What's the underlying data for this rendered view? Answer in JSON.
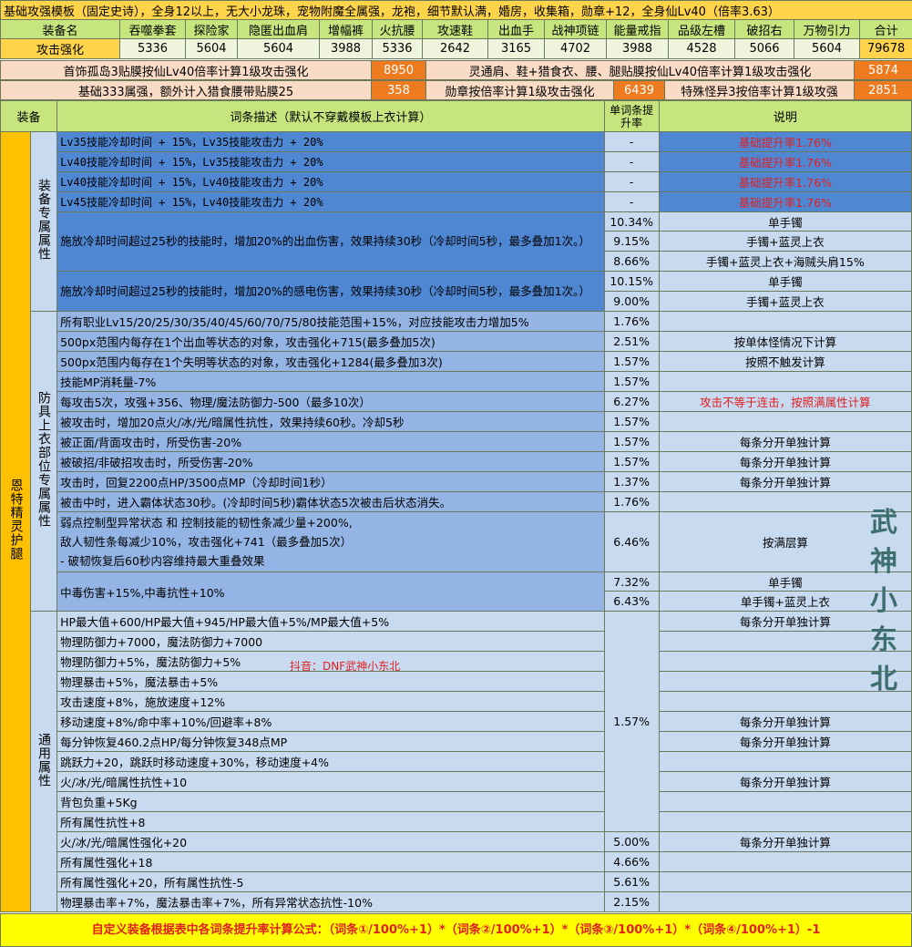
{
  "title": "基础攻强模板（固定史诗），全身12以上，无大小龙珠，宠物附魔全属强，龙袍，细节默认满，婚房，收集箱，勋章+12，全身仙Lv40（倍率3.63）",
  "header_row": {
    "label": "装备名",
    "items": [
      "吞噬拳套",
      "探险家",
      "隐匿出血肩",
      "增幅裤",
      "火抗腰",
      "攻速鞋",
      "出血手",
      "战神项链",
      "能量戒指",
      "品级左槽",
      "破招右",
      "万物引力"
    ],
    "total_label": "合计"
  },
  "attack_row": {
    "label": "攻击强化",
    "values": [
      "5336",
      "5604",
      "5604",
      "3988",
      "5336",
      "2642",
      "3165",
      "4702",
      "3988",
      "4528",
      "5066",
      "5604"
    ],
    "total": "79678"
  },
  "extra_rows": [
    {
      "left_label": "首饰孤岛3贴膜按仙Lv40倍率计算1级攻击强化",
      "left_value": "8950",
      "right_label": "灵通肩、鞋+猎食衣、腰、腿贴膜按仙Lv40倍率计算1级攻击强化",
      "right_value": "5874"
    },
    {
      "left_label": "基础333属强，额外计入猎食腰带贴膜25",
      "left_value": "358",
      "mid_label": "勋章按倍率计算1级攻击强化",
      "mid_value": "6439",
      "right_label": "特殊怪异3按倍率计算1级攻强",
      "right_value": "2851"
    }
  ],
  "table_header": {
    "equip": "装备",
    "desc": "词条描述（默认不穿戴模板上衣计算）",
    "rate": "单词条提升率",
    "note": "说明"
  },
  "equipment_name": "恩特精灵护腿",
  "groups": {
    "exclusive": "装备专属属性",
    "top": "防具上衣部位专属属性",
    "common": "通用属性"
  },
  "rows_exclusive": [
    {
      "desc": "Lv35技能冷却时间 + 15%，Lv35技能攻击力 + 20%",
      "rate": "-",
      "note": "基础提升率1.76%"
    },
    {
      "desc": "Lv40技能冷却时间 + 15%，Lv35技能攻击力 + 20%",
      "rate": "-",
      "note": "基础提升率1.76%"
    },
    {
      "desc": "Lv40技能冷却时间 + 15%，Lv40技能攻击力 + 20%",
      "rate": "-",
      "note": "基础提升率1.76%"
    },
    {
      "desc": "Lv45技能冷却时间 + 15%，Lv40技能攻击力 + 20%",
      "rate": "-",
      "note": "基础提升率1.76%"
    }
  ],
  "bleed_block": {
    "desc": "施放冷却时间超过25秒的技能时，增加20%的出血伤害，效果持续30秒（冷却时间5秒，最多叠加1次。）",
    "subs": [
      {
        "rate": "10.34%",
        "note": "单手镯"
      },
      {
        "rate": "9.15%",
        "note": "手镯+蓝灵上衣"
      },
      {
        "rate": "8.66%",
        "note": "手镯+蓝灵上衣+海贼头肩15%"
      }
    ]
  },
  "shock_block": {
    "desc": "施放冷却时间超过25秒的技能时，增加20%的感电伤害，效果持续30秒（冷却时间5秒，最多叠加1次。）",
    "subs": [
      {
        "rate": "10.15%",
        "note": "单手镯"
      },
      {
        "rate": "9.00%",
        "note": "手镯+蓝灵上衣"
      }
    ]
  },
  "rows_top": [
    {
      "desc": "所有职业Lv15/20/25/30/35/40/45/60/70/75/80技能范围+15%，对应技能攻击力增加5%",
      "rate": "1.76%",
      "note": ""
    },
    {
      "desc": "500px范围内每存在1个出血等状态的对象，攻击强化+715(最多叠加5次)",
      "rate": "2.51%",
      "note": "按单体怪情况下计算"
    },
    {
      "desc": "500px范围内每存在1个失明等状态的对象，攻击强化+1284(最多叠加3次)",
      "rate": "1.57%",
      "note": "按照不触发计算"
    },
    {
      "desc": "技能MP消耗量-7%",
      "rate": "1.57%",
      "note": ""
    },
    {
      "desc": "每攻击5次，攻强+356、物理/魔法防御力-500（最多10次）",
      "rate": "6.27%",
      "note": "攻击不等于连击，按照满属性计算"
    },
    {
      "desc": "被攻击时，增加20点火/冰/光/暗属性抗性，效果持续60秒。冷却5秒",
      "rate": "1.57%",
      "note": ""
    },
    {
      "desc": "被正面/背面攻击时，所受伤害-20%",
      "rate": "1.57%",
      "note": "每条分开单独计算"
    },
    {
      "desc": "被破招/非破招攻击时，所受伤害-20%",
      "rate": "1.57%",
      "note": "每条分开单独计算"
    },
    {
      "desc": "攻击时，回复2200点HP/3500点MP（冷却时间1秒）",
      "rate": "1.37%",
      "note": "每条分开单独计算"
    },
    {
      "desc": "被击中时，进入霸体状态30秒。(冷却时间5秒)霸体状态5次被击后状态消失。",
      "rate": "1.76%",
      "note": ""
    }
  ],
  "weak_block": {
    "lines": [
      "弱点控制型异常状态 和 控制技能的韧性条减少量+200%,",
      "敌人韧性条每减少10%，攻击强化+741（最多叠加5次）",
      "- 破韧恢复后60秒内容维持最大重叠效果"
    ],
    "rate": "6.46%",
    "note": "按满层算"
  },
  "poison_block": {
    "desc": "中毒伤害+15%,中毒抗性+10%",
    "subs": [
      {
        "rate": "7.32%",
        "note": "单手镯"
      },
      {
        "rate": "6.43%",
        "note": "单手镯+蓝灵上衣"
      }
    ]
  },
  "rows_common": [
    {
      "desc": "HP最大值+600/HP最大值+945/HP最大值+5%/MP最大值+5%",
      "note": "每条分开单独计算"
    },
    {
      "desc": "物理防御力+7000，魔法防御力+7000",
      "note": ""
    },
    {
      "desc": "物理防御力+5%，魔法防御力+5%",
      "note": ""
    },
    {
      "desc": "物理暴击+5%，魔法暴击+5%",
      "note": ""
    },
    {
      "desc": "攻击速度+8%，施放速度+12%",
      "note": ""
    },
    {
      "desc": "移动速度+8%/命中率+10%/回避率+8%",
      "note": "每条分开单独计算"
    },
    {
      "desc": "每分钟恢复460.2点HP/每分钟恢复348点MP",
      "note": "每条分开单独计算"
    },
    {
      "desc": "跳跃力+20，跳跃时移动速度+30%，移动速度+4%",
      "note": ""
    },
    {
      "desc": "火/冰/光/暗属性抗性+10",
      "note": "每条分开单独计算"
    },
    {
      "desc": "背包负重+5Kg",
      "note": ""
    },
    {
      "desc": "所有属性抗性+8",
      "note": ""
    }
  ],
  "common_rate": "1.57%",
  "rows_tail": [
    {
      "desc": "火/冰/光/暗属性强化+20",
      "rate": "5.00%",
      "note": "每条分开单独计算"
    },
    {
      "desc": "所有属性强化+18",
      "rate": "4.66%",
      "note": ""
    },
    {
      "desc": "所有属性强化+20，所有属性抗性-5",
      "rate": "5.61%",
      "note": ""
    },
    {
      "desc": "物理暴击率+7%，魔法暴击率+7%，所有异常状态抗性-10%",
      "rate": "2.15%",
      "note": ""
    }
  ],
  "doujin_note": "抖音：DNF武神小东北",
  "watermark": "武神小东北",
  "footer": "自定义装备根据表中各词条提升率计算公式：（词条①/100%+1）*（词条②/100%+1）*（词条③/100%+1）*（词条④/100%+1）-1",
  "colors": {
    "green": "#c6e57e",
    "yellow": "#ffd34a",
    "orange": "#ee7b20",
    "dark_blue": "#4f87d3",
    "mid_blue": "#93b4e4",
    "light_blue": "#c8daf0",
    "red": "#e02020",
    "footer_yellow": "#ffff00"
  }
}
